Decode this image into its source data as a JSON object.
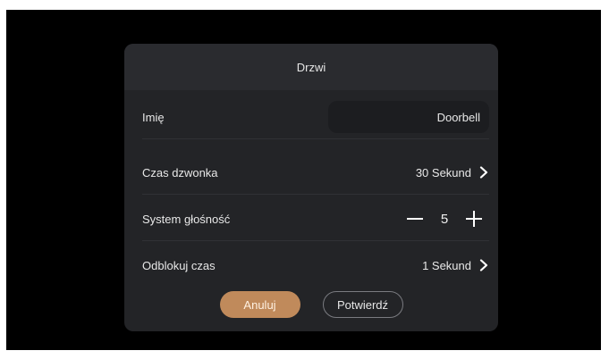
{
  "dialog": {
    "title": "Drzwi",
    "rows": {
      "name": {
        "label": "Imię",
        "value": "Doorbell"
      },
      "ring_time": {
        "label": "Czas dzwonka",
        "value": "30 Sekund"
      },
      "volume": {
        "label": "System głośność",
        "value": "5",
        "minus_icon": "minus-icon",
        "plus_icon": "plus-icon"
      },
      "unlock_time": {
        "label": "Odblokuj czas",
        "value": "1 Sekund"
      }
    },
    "buttons": {
      "cancel_label": "Anuluj",
      "confirm_label": "Potwierdź"
    }
  },
  "colors": {
    "accent": "#c08a5b",
    "dialog_bg": "#232427",
    "screen_bg": "#000000"
  }
}
